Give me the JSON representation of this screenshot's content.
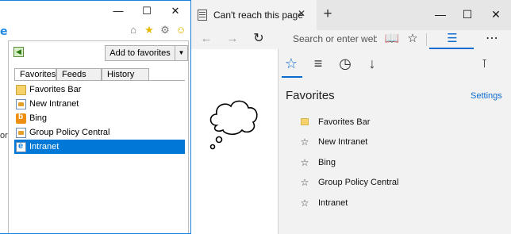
{
  "ie": {
    "left_text": "or",
    "add_favorites_label": "Add to favorites",
    "tabs": [
      "Favorites",
      "Feeds",
      "History"
    ],
    "items": [
      {
        "label": "Favorites Bar",
        "icon": "folder-icon"
      },
      {
        "label": "New Intranet",
        "icon": "page-icon"
      },
      {
        "label": "Bing",
        "icon": "bing-icon"
      },
      {
        "label": "Group Policy Central",
        "icon": "page-icon"
      },
      {
        "label": "Intranet",
        "icon": "ie-icon",
        "selected": true
      }
    ],
    "colors": {
      "selected": "#0078d7",
      "border": "#1e7fd6"
    }
  },
  "edge": {
    "tab_title": "Can't reach this page",
    "address_placeholder": "Search or enter web ac",
    "hub": {
      "title": "Favorites",
      "settings_label": "Settings",
      "items": [
        {
          "label": "Favorites Bar",
          "icon": "folder-icon"
        },
        {
          "label": "New Intranet",
          "icon": "star-icon"
        },
        {
          "label": "Bing",
          "icon": "star-icon"
        },
        {
          "label": "Group Policy Central",
          "icon": "star-icon"
        },
        {
          "label": "Intranet",
          "icon": "star-icon"
        }
      ]
    },
    "colors": {
      "accent": "#0b6bcf",
      "hub_bg": "#f2f2f2",
      "tab_bg": "#e6e6e6"
    }
  }
}
